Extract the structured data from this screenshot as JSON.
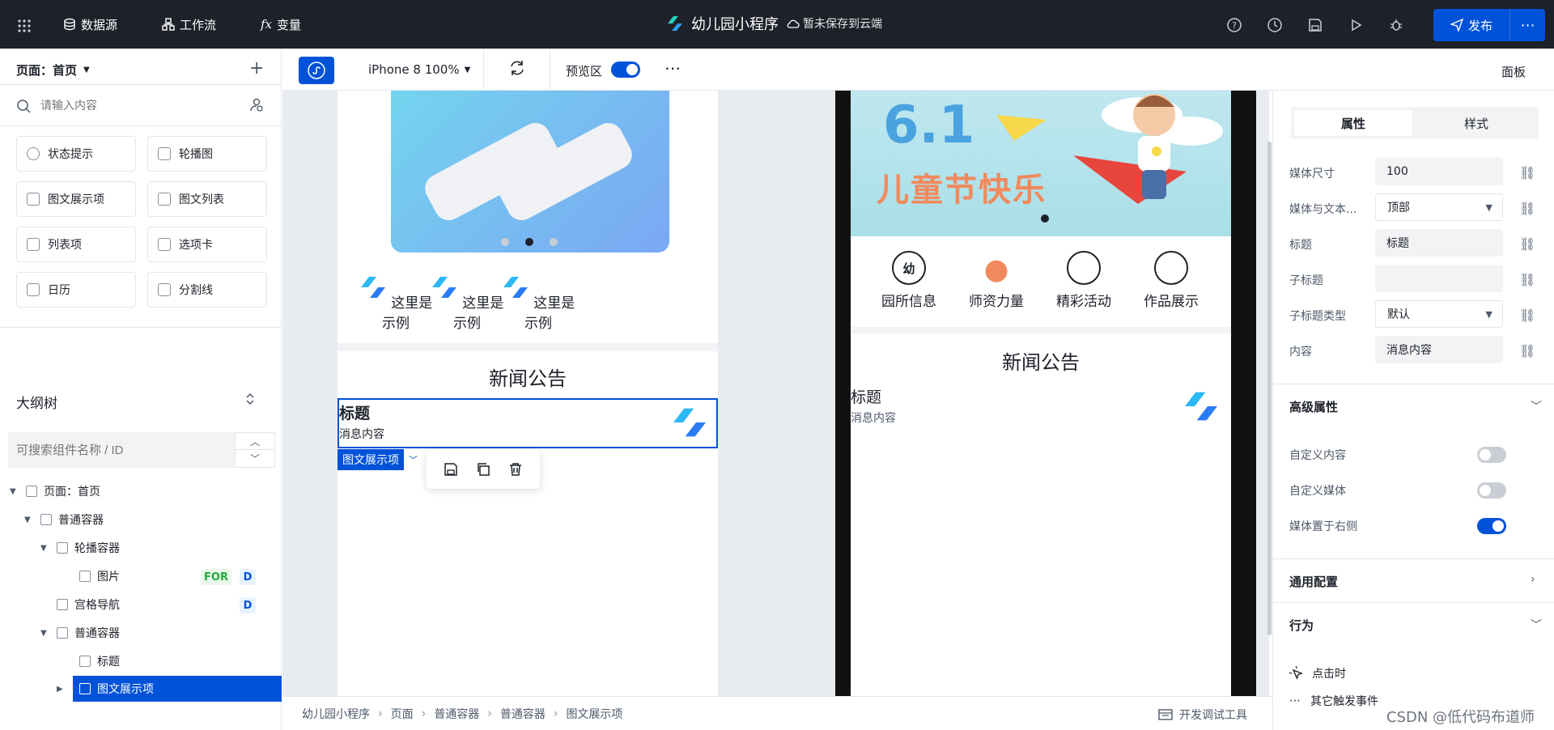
{
  "topbar": {
    "datasource": "数据源",
    "workflow": "工作流",
    "variables": "变量",
    "app_title": "幼儿园小程序",
    "save_status": "暂未保存到云端",
    "publish": "发布"
  },
  "left_panel": {
    "page_selector": "页面：首页",
    "search_placeholder": "请输入内容",
    "components": [
      "状态提示",
      "轮播图",
      "图文展示项",
      "图文列表",
      "列表项",
      "选项卡",
      "日历",
      "分割线"
    ],
    "outline_title": "大纲树",
    "outline_search_placeholder": "可搜索组件名称 / ID",
    "tree": [
      {
        "label": "页面：首页"
      },
      {
        "label": "普通容器"
      },
      {
        "label": "轮播容器"
      },
      {
        "label": "图片",
        "tags": [
          "FOR",
          "D"
        ]
      },
      {
        "label": "宫格导航",
        "tags": [
          "D"
        ]
      },
      {
        "label": "普通容器"
      },
      {
        "label": "标题"
      },
      {
        "label": "图文展示项"
      }
    ]
  },
  "canvas_toolbar": {
    "device": "iPhone 8 100%",
    "preview_label": "预览区",
    "preview_on": true,
    "panel_label": "面板"
  },
  "editor": {
    "nav_items": [
      "这里是示例",
      "这里是示例",
      "这里是示例"
    ],
    "news_title": "新闻公告",
    "item_title": "标题",
    "item_content": "消息内容",
    "selected_label": "图文展示项"
  },
  "preview": {
    "banner_line1": "6.1",
    "banner_line2": "儿童节快乐",
    "nav_items": [
      "园所信息",
      "师资力量",
      "精彩活动",
      "作品展示"
    ],
    "nav_icon_badge": "幼",
    "news_title": "新闻公告",
    "item_title": "标题",
    "item_content": "消息内容"
  },
  "right_panel": {
    "tabs": [
      "属性",
      "样式"
    ],
    "props": [
      {
        "label": "媒体尺寸",
        "value": "100"
      },
      {
        "label": "媒体与文本...",
        "value": "顶部",
        "select": true
      },
      {
        "label": "标题",
        "value": "标题"
      },
      {
        "label": "子标题",
        "value": ""
      },
      {
        "label": "子标题类型",
        "value": "默认",
        "select": true
      },
      {
        "label": "内容",
        "value": "消息内容"
      }
    ],
    "advanced_title": "高级属性",
    "toggles": [
      {
        "label": "自定义内容",
        "on": false
      },
      {
        "label": "自定义媒体",
        "on": false
      },
      {
        "label": "媒体置于右侧",
        "on": true
      }
    ],
    "common_config": "通用配置",
    "behavior": "行为",
    "on_click": "点击时",
    "other_events": "其它触发事件"
  },
  "breadcrumb": [
    "幼儿园小程序",
    "页面",
    "普通容器",
    "普通容器",
    "图文展示项"
  ],
  "devtools": "开发调试工具",
  "watermark": "CSDN @低代码布道师",
  "colors": {
    "accent": "#0052d9",
    "topbar": "#1e2129"
  }
}
